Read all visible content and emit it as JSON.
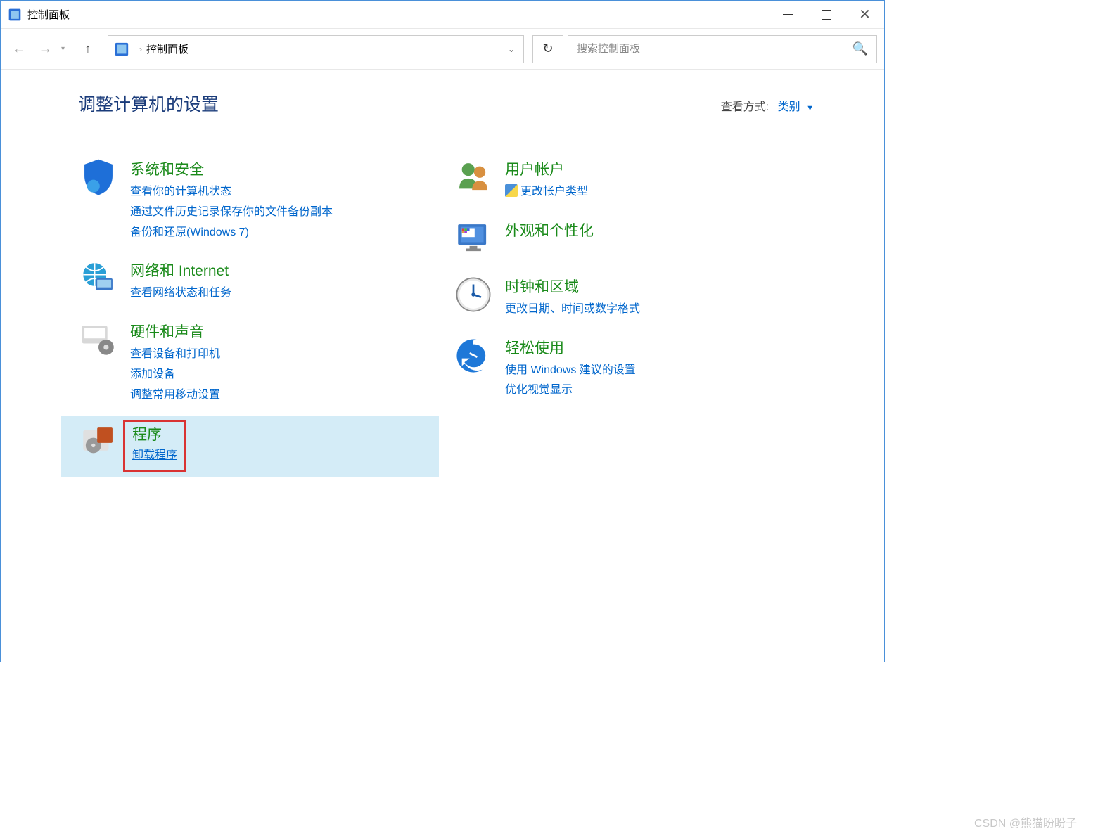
{
  "window": {
    "title": "控制面板"
  },
  "address": {
    "path": "控制面板"
  },
  "search": {
    "placeholder": "搜索控制面板"
  },
  "heading": "调整计算机的设置",
  "viewBy": {
    "label": "查看方式:",
    "value": "类别"
  },
  "left": [
    {
      "id": "system-security",
      "title": "系统和安全",
      "links": [
        "查看你的计算机状态",
        "通过文件历史记录保存你的文件备份副本",
        "备份和还原(Windows 7)"
      ]
    },
    {
      "id": "network",
      "title": "网络和 Internet",
      "links": [
        "查看网络状态和任务"
      ]
    },
    {
      "id": "hardware-sound",
      "title": "硬件和声音",
      "links": [
        "查看设备和打印机",
        "添加设备",
        "调整常用移动设置"
      ]
    },
    {
      "id": "programs",
      "title": "程序",
      "links": [
        "卸载程序"
      ],
      "highlighted": true,
      "redbox": true
    }
  ],
  "right": [
    {
      "id": "user-accounts",
      "title": "用户帐户",
      "links": [
        "更改帐户类型"
      ],
      "shield": [
        0
      ]
    },
    {
      "id": "appearance",
      "title": "外观和个性化",
      "links": []
    },
    {
      "id": "clock-region",
      "title": "时钟和区域",
      "links": [
        "更改日期、时间或数字格式"
      ]
    },
    {
      "id": "ease-of-access",
      "title": "轻松使用",
      "links": [
        "使用 Windows 建议的设置",
        "优化视觉显示"
      ]
    }
  ],
  "watermark": "CSDN @熊猫盼盼子"
}
